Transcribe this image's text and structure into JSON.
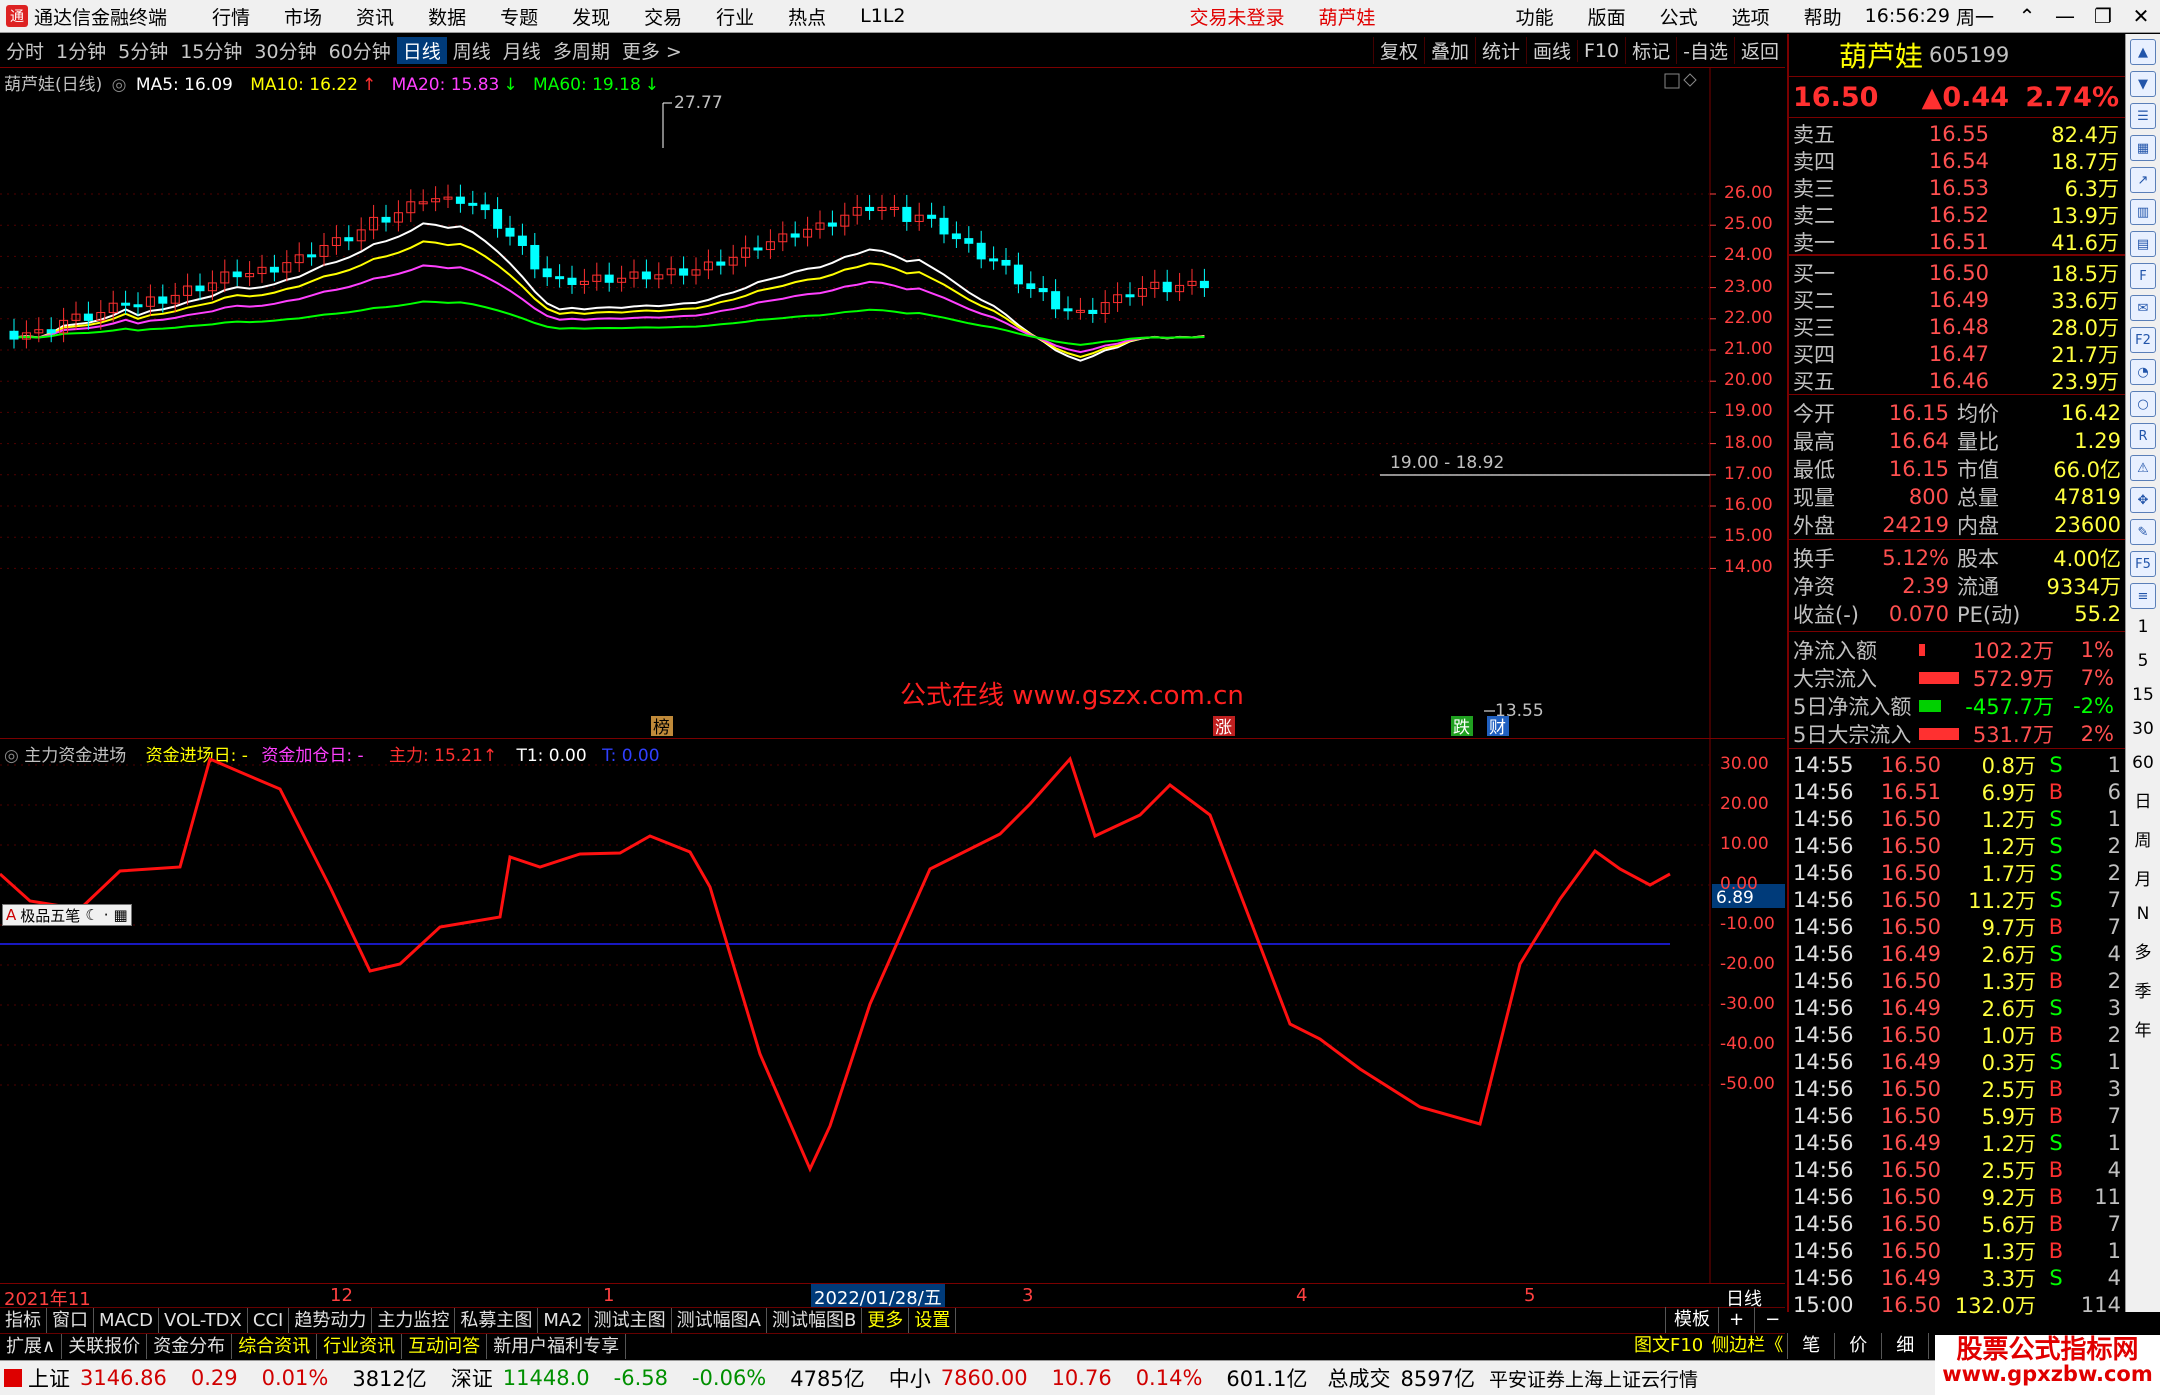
{
  "menubar": {
    "app_title": "通达信金融终端",
    "items": [
      "行情",
      "市场",
      "资讯",
      "数据",
      "专题",
      "发现",
      "交易",
      "行业",
      "热点",
      "L1L2"
    ],
    "trade_status": "交易未登录",
    "stock_name": "葫芦娃",
    "right_items": [
      "功能",
      "版面",
      "公式",
      "选项",
      "帮助"
    ],
    "time": "16:56:29",
    "weekday": "周一"
  },
  "toolbar": {
    "periods": [
      "分时",
      "1分钟",
      "5分钟",
      "15分钟",
      "30分钟",
      "60分钟",
      "日线",
      "周线",
      "月线",
      "多周期",
      "更多 >"
    ],
    "active_period": "日线",
    "right": [
      "复权",
      "叠加",
      "统计",
      "画线",
      "F10",
      "标记",
      "-自选",
      "返回"
    ]
  },
  "price_chart": {
    "title": "葫芦娃(日线)",
    "ma": [
      {
        "label": "MA5: 16.09",
        "color": "#ffffff"
      },
      {
        "label": "MA10: 16.22",
        "color": "#ffff00"
      },
      {
        "label": "MA20: 15.83",
        "color": "#ff40ff"
      },
      {
        "label": "MA60: 19.18",
        "color": "#00ff00"
      }
    ],
    "y_ticks": [
      "26.00",
      "25.00",
      "24.00",
      "23.00",
      "22.00",
      "21.00",
      "20.00",
      "19.00",
      "18.00",
      "17.00",
      "16.00",
      "15.00",
      "14.00"
    ],
    "high_label": "27.77",
    "low_label": "13.55",
    "range_label": "19.00 - 18.92",
    "watermark": "公式在线  www.gszx.com.cn",
    "markers": [
      "榜",
      "涨",
      "跌",
      "财"
    ]
  },
  "indicator": {
    "title": "主力资金进场",
    "l1": "资金进场日: -",
    "l2": "资金加仓日: -",
    "l3": "主力: 15.21",
    "l4": "T1: 0.00",
    "l5": "T: 0.00",
    "y_ticks": [
      "30.00",
      "20.00",
      "10.00",
      "0.00",
      "-10.00",
      "-20.00",
      "-30.00",
      "-40.00",
      "-50.00"
    ],
    "current": "6.89",
    "overlay": "极品五笔"
  },
  "date_axis": {
    "labels": [
      "2021年11",
      "12",
      "1",
      "2022/01/28/五",
      "3",
      "4",
      "5"
    ],
    "right": "日线"
  },
  "quote": {
    "name": "葫芦娃",
    "code": "605199",
    "price": "16.50",
    "change": "▲0.44",
    "pct": "2.74%",
    "asks": [
      {
        "l": "卖五",
        "p": "16.55",
        "v": "82.4万"
      },
      {
        "l": "卖四",
        "p": "16.54",
        "v": "18.7万"
      },
      {
        "l": "卖三",
        "p": "16.53",
        "v": "6.3万"
      },
      {
        "l": "卖二",
        "p": "16.52",
        "v": "13.9万"
      },
      {
        "l": "卖一",
        "p": "16.51",
        "v": "41.6万"
      }
    ],
    "bids": [
      {
        "l": "买一",
        "p": "16.50",
        "v": "18.5万"
      },
      {
        "l": "买二",
        "p": "16.49",
        "v": "33.6万"
      },
      {
        "l": "买三",
        "p": "16.48",
        "v": "28.0万"
      },
      {
        "l": "买四",
        "p": "16.47",
        "v": "21.7万"
      },
      {
        "l": "买五",
        "p": "16.46",
        "v": "23.9万"
      }
    ],
    "stats": [
      {
        "a": "今开",
        "b": "16.15",
        "c": "均价",
        "d": "16.42"
      },
      {
        "a": "最高",
        "b": "16.64",
        "c": "量比",
        "d": "1.29"
      },
      {
        "a": "最低",
        "b": "16.15",
        "c": "市值",
        "d": "66.0亿"
      },
      {
        "a": "现量",
        "b": "800",
        "c": "总量",
        "d": "47819"
      },
      {
        "a": "外盘",
        "b": "24219",
        "c": "内盘",
        "d": "23600"
      }
    ],
    "stats2": [
      {
        "a": "换手",
        "b": "5.12%",
        "c": "股本",
        "d": "4.00亿"
      },
      {
        "a": "净资",
        "b": "2.39",
        "c": "流通",
        "d": "9334万"
      },
      {
        "a": "收益(-)",
        "b": "0.070",
        "c": "PE(动)",
        "d": "55.2"
      }
    ],
    "flows": [
      {
        "a": "净流入额",
        "v": "102.2万",
        "p": "1%",
        "w": 6,
        "c": "#ff3030"
      },
      {
        "a": "大宗流入",
        "v": "572.9万",
        "p": "7%",
        "w": 40,
        "c": "#ff3030"
      },
      {
        "a": "5日净流入额",
        "v": "-457.7万",
        "p": "-2%",
        "w": 22,
        "c": "#00d000"
      },
      {
        "a": "5日大宗流入",
        "v": "531.7万",
        "p": "2%",
        "w": 40,
        "c": "#ff3030"
      }
    ],
    "ticks": [
      {
        "t": "14:55",
        "p": "16.50",
        "v": "0.8万",
        "s": "S",
        "n": "1"
      },
      {
        "t": "14:56",
        "p": "16.51",
        "v": "6.9万",
        "s": "B",
        "n": "6"
      },
      {
        "t": "14:56",
        "p": "16.50",
        "v": "1.2万",
        "s": "S",
        "n": "1"
      },
      {
        "t": "14:56",
        "p": "16.50",
        "v": "1.2万",
        "s": "S",
        "n": "2"
      },
      {
        "t": "14:56",
        "p": "16.50",
        "v": "1.7万",
        "s": "S",
        "n": "2"
      },
      {
        "t": "14:56",
        "p": "16.50",
        "v": "11.2万",
        "s": "S",
        "n": "7"
      },
      {
        "t": "14:56",
        "p": "16.50",
        "v": "9.7万",
        "s": "B",
        "n": "7"
      },
      {
        "t": "14:56",
        "p": "16.49",
        "v": "2.6万",
        "s": "S",
        "n": "4"
      },
      {
        "t": "14:56",
        "p": "16.50",
        "v": "1.3万",
        "s": "B",
        "n": "2"
      },
      {
        "t": "14:56",
        "p": "16.49",
        "v": "2.6万",
        "s": "S",
        "n": "3"
      },
      {
        "t": "14:56",
        "p": "16.50",
        "v": "1.0万",
        "s": "B",
        "n": "2"
      },
      {
        "t": "14:56",
        "p": "16.49",
        "v": "0.3万",
        "s": "S",
        "n": "1"
      },
      {
        "t": "14:56",
        "p": "16.50",
        "v": "2.5万",
        "s": "B",
        "n": "3"
      },
      {
        "t": "14:56",
        "p": "16.50",
        "v": "5.9万",
        "s": "B",
        "n": "7"
      },
      {
        "t": "14:56",
        "p": "16.49",
        "v": "1.2万",
        "s": "S",
        "n": "1"
      },
      {
        "t": "14:56",
        "p": "16.50",
        "v": "2.5万",
        "s": "B",
        "n": "4"
      },
      {
        "t": "14:56",
        "p": "16.50",
        "v": "9.2万",
        "s": "B",
        "n": "11"
      },
      {
        "t": "14:56",
        "p": "16.50",
        "v": "5.6万",
        "s": "B",
        "n": "7"
      },
      {
        "t": "14:56",
        "p": "16.50",
        "v": "1.3万",
        "s": "B",
        "n": "1"
      },
      {
        "t": "14:56",
        "p": "16.49",
        "v": "3.3万",
        "s": "S",
        "n": "4"
      },
      {
        "t": "15:00",
        "p": "16.50",
        "v": "132.0万",
        "s": "",
        "n": "114"
      }
    ]
  },
  "tabs1": [
    "指标",
    "窗口",
    "MACD",
    "VOL-TDX",
    "CCI",
    "趋势动力",
    "主力监控",
    "私募主图",
    "MA2",
    "测试主图",
    "测试幅图A",
    "测试幅图B",
    "更多",
    "设置"
  ],
  "tabs1_right": [
    "模板",
    "+",
    "−"
  ],
  "tabs2": [
    "扩展∧",
    "关联报价",
    "资金分布",
    "综合资讯",
    "行业资讯",
    "互动问答",
    "新用户福利专享"
  ],
  "tabs2_right": [
    "图文F10",
    "侧边栏《",
    "笔",
    "价",
    "细",
    "势"
  ],
  "status": {
    "sh_label": "上证",
    "sh": "3146.86",
    "sh_chg": "0.29",
    "sh_pct": "0.01%",
    "sh_amt": "3812亿",
    "sz_label": "深证",
    "sz": "11448.0",
    "sz_chg": "-6.58",
    "sz_pct": "-0.06%",
    "sz_amt": "4785亿",
    "zx_label": "中小",
    "zx": "7860.00",
    "zx_chg": "10.76",
    "zx_pct": "0.14%",
    "zx_amt": "601.1亿",
    "total_label": "总成交",
    "total": "8597亿",
    "broker": "平安证券上海上证云行情"
  },
  "brand": {
    "line1": "股票公式指标网",
    "line2": "www.gpxzbw.com"
  },
  "sidebar": {
    "icons": [
      "arrow-up-icon",
      "arrow-down-icon",
      "list-icon",
      "grid-icon",
      "chart-line-icon",
      "candle-icon",
      "table-icon",
      "f10-icon",
      "news-icon",
      "f2-icon",
      "pie-icon",
      "circle-icon",
      "rsi-icon",
      "alert-icon",
      "move-icon",
      "pen-icon",
      "f5-icon",
      "ladder-icon"
    ],
    "periods": [
      "1",
      "5",
      "15",
      "30",
      "60",
      "日",
      "周",
      "月",
      "N",
      "多",
      "季",
      "年"
    ]
  }
}
